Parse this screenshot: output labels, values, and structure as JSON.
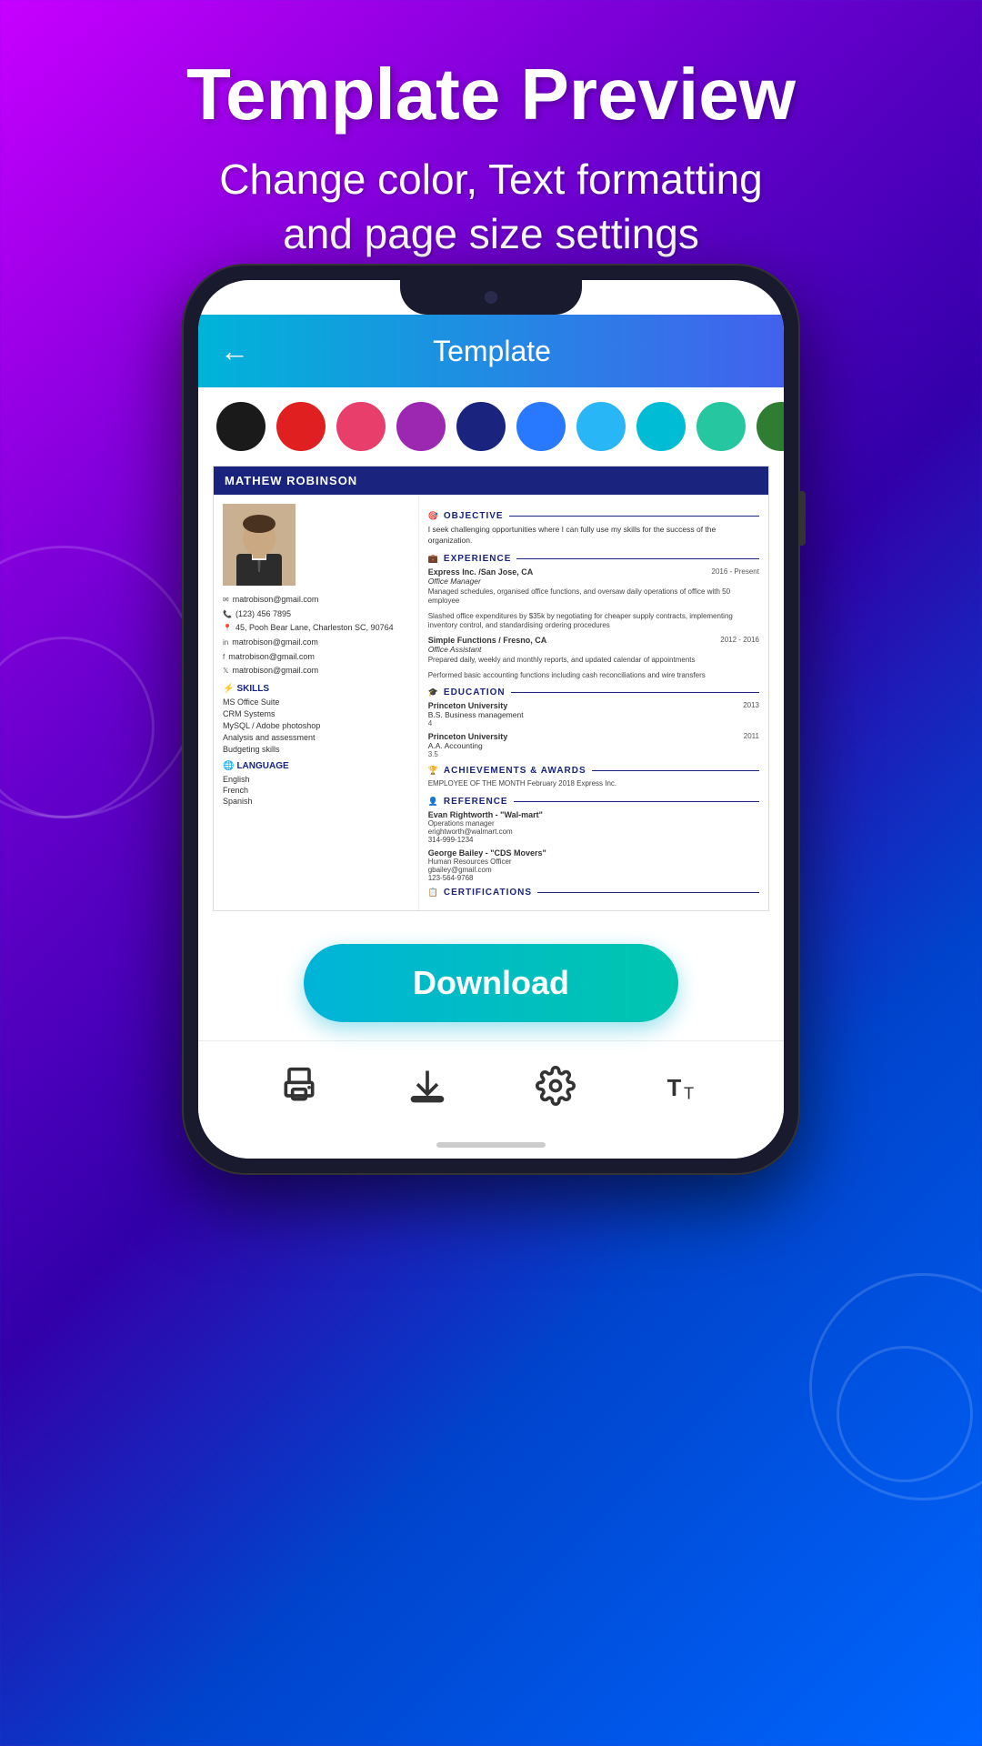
{
  "page": {
    "background_gradient": "linear-gradient(135deg, #c800ff 0%, #6600cc 30%, #3300aa 50%, #0044cc 70%, #0066ff 100%)"
  },
  "header": {
    "main_title": "Template Preview",
    "subtitle": "Change color, Text formatting\nand page size settings"
  },
  "app": {
    "title": "Template",
    "back_label": "←"
  },
  "color_palette": {
    "colors": [
      {
        "name": "black",
        "hex": "#1a1a1a"
      },
      {
        "name": "red",
        "hex": "#e02020"
      },
      {
        "name": "pink",
        "hex": "#e83e6c"
      },
      {
        "name": "purple",
        "hex": "#9c27b0"
      },
      {
        "name": "navy",
        "hex": "#1a237e"
      },
      {
        "name": "blue",
        "hex": "#2979ff"
      },
      {
        "name": "light-blue",
        "hex": "#29b6f6"
      },
      {
        "name": "cyan",
        "hex": "#00bcd4"
      },
      {
        "name": "teal",
        "hex": "#26c6a0"
      },
      {
        "name": "dark-green",
        "hex": "#2e7d32"
      }
    ]
  },
  "resume": {
    "name": "MATHEW ROBINSON",
    "photo_alt": "Profile photo of Mathew Robinson",
    "contact": {
      "email": "matrobison@gmail.com",
      "phone": "(123) 456 7895",
      "address": "45, Pooh Bear Lane, Charleston SC, 90764",
      "linkedin": "matrobison@gmail.com",
      "facebook": "matrobison@gmail.com",
      "twitter": "matrobison@gmail.com"
    },
    "sections": {
      "objective": {
        "title": "OBJECTIVE",
        "text": "I seek challenging opportunities where I can fully use my skills for the success of the organization."
      },
      "experience": {
        "title": "EXPERIENCE",
        "jobs": [
          {
            "company": "Express Inc. /San Jose, CA",
            "date": "2016 - Present",
            "title": "Office Manager",
            "desc": "Managed schedules, organised office functions, and oversaw daily operations of office with 50 employee"
          },
          {
            "company": "",
            "date": "",
            "title": "",
            "desc": "Slashed office expenditures by $35k by negotiating for cheaper supply contracts, implementing inventory control, and standardising ordering procedures"
          },
          {
            "company": "Simple Functions / Fresno, CA",
            "date": "2012 - 2016",
            "title": "Office Assistant",
            "desc": "Prepared daily, weekly and monthly reports, and updated calendar of appointments"
          },
          {
            "company": "",
            "date": "",
            "title": "",
            "desc": "Performed basic accounting functions including cash reconciliations and wire transfers"
          }
        ]
      },
      "education": {
        "title": "EDUCATION",
        "schools": [
          {
            "name": "Princeton University",
            "date": "2013",
            "degree": "B.S. Business management",
            "gpa": "4"
          },
          {
            "name": "Princeton University",
            "date": "2011",
            "degree": "A.A. Accounting",
            "gpa": "3.5"
          }
        ]
      },
      "achievements": {
        "title": "ACHIEVEMENTS & AWARDS",
        "items": [
          "EMPLOYEE OF THE MONTH February 2018 Express Inc."
        ]
      },
      "reference": {
        "title": "REFERENCE",
        "refs": [
          {
            "name": "Evan Rightworth - \"Wal-mart\"",
            "title": "Operations manager",
            "email": "erightworth@walmart.com",
            "phone": "314-999-1234"
          },
          {
            "name": "George Bailey - \"CDS Movers\"",
            "title": "Human Resources Officer",
            "email": "gbailey@gmail.com",
            "phone": "123-564-9768"
          }
        ]
      },
      "certifications": {
        "title": "CERTIFICATIONS"
      },
      "skills": {
        "title": "SKILLS",
        "items": [
          "MS Office Suite",
          "CRM Systems",
          "MySQL / Adobe photoshop",
          "Analysis and assessment",
          "Budgeting skills"
        ]
      },
      "language": {
        "title": "LANGUAGE",
        "items": [
          "English",
          "French",
          "Spanish"
        ]
      }
    }
  },
  "download_button": {
    "label": "Download"
  },
  "bottom_nav": {
    "items": [
      {
        "name": "print",
        "icon": "printer-icon"
      },
      {
        "name": "download",
        "icon": "download-icon"
      },
      {
        "name": "settings",
        "icon": "settings-icon"
      },
      {
        "name": "text-size",
        "icon": "text-size-icon"
      }
    ]
  }
}
